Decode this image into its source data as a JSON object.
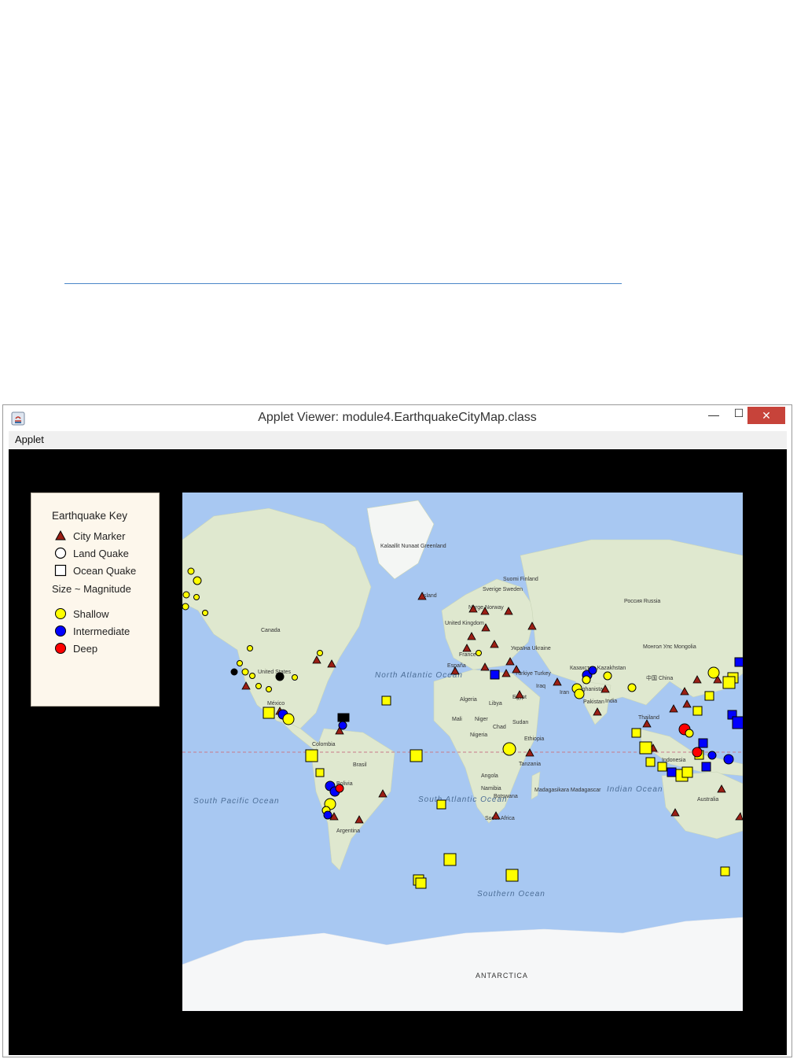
{
  "window": {
    "title": "Applet Viewer: module4.EarthquakeCityMap.class",
    "menu": "Applet",
    "close_glyph": "✕",
    "min_glyph": "—",
    "max_glyph": "☐"
  },
  "legend": {
    "title": "Earthquake Key",
    "city_marker": "City Marker",
    "land_quake": "Land Quake",
    "ocean_quake": "Ocean Quake",
    "size_note": "Size ~ Magnitude",
    "shallow": "Shallow",
    "intermediate": "Intermediate",
    "deep": "Deep"
  },
  "colors": {
    "shallow": "#ffff00",
    "intermediate": "#0000ff",
    "deep": "#ff0000",
    "city": "#9b1e14",
    "land": "#dfe8cf",
    "ocean": "#a8c8f2"
  },
  "map_labels": {
    "greenland": "Kalaallit Nunaat Greenland",
    "canada": "Canada",
    "united_states": "United States",
    "mexico": "México",
    "colombia": "Colombia",
    "brasil": "Brasil",
    "bolivia": "Bolivia",
    "argentina": "Argentina",
    "north_atlantic": "North Atlantic Ocean",
    "south_atlantic": "South Atlantic Ocean",
    "south_pacific": "South Pacific Ocean",
    "indian_ocean": "Indian Ocean",
    "southern_ocean": "Southern Ocean",
    "antarctica": "ANTARCTICA",
    "australia": "Australia",
    "russia": "Россия Russia",
    "china": "中国 China",
    "india": "India",
    "kazakhstan": "Казахстан Kazakhstan",
    "mongolia": "Монгол Улс Mongolia",
    "iran": "Iran",
    "iraq": "Iraq",
    "egypt": "Egypt",
    "libya": "Libya",
    "algeria": "Algeria",
    "mali": "Mali",
    "niger": "Niger",
    "chad": "Chad",
    "sudan": "Sudan",
    "nigeria": "Nigeria",
    "ethiopia": "Ethiopia",
    "tanzania": "Tanzania",
    "angola": "Angola",
    "namibia": "Namibia",
    "botswana": "Botswana",
    "madagascar": "Madagasikara Madagascar",
    "south_africa": "South Africa",
    "indonesia": "Indonesia",
    "thailand": "Thailand",
    "united_kingdom": "United Kingdom",
    "france": "France",
    "espana": "España",
    "ukraine": "Україна Ukraine",
    "turkey": "Türkiye Turkey",
    "sverige": "Sverige Sweden",
    "suomi": "Suomi Finland",
    "norge": "Norge Norway",
    "iceland": "Ísland",
    "pakistan": "Pakistan",
    "afghanistan": "Afghanistan"
  }
}
